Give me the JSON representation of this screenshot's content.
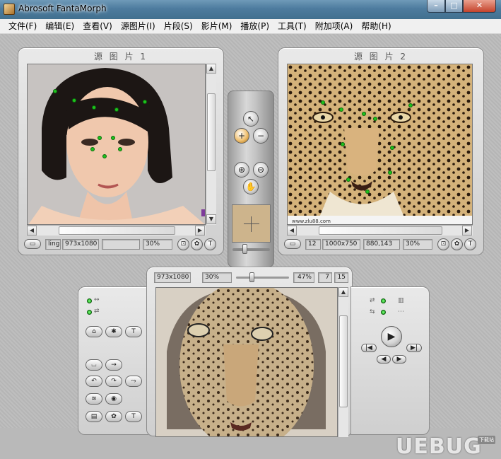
{
  "window": {
    "title": "Abrosoft FantaMorph",
    "min": "–",
    "max": "□",
    "close": "✕"
  },
  "menu": [
    "文件(F)",
    "编辑(E)",
    "查看(V)",
    "源图片(I)",
    "片段(S)",
    "影片(M)",
    "播放(P)",
    "工具(T)",
    "附加项(A)",
    "帮助(H)"
  ],
  "source1": {
    "title": "源 图 片 1",
    "name": "ling",
    "size": "973x1080",
    "coords": "",
    "zoom": "30%"
  },
  "source2": {
    "title": "源 图 片 2",
    "name": "12",
    "size": "1000x750",
    "coords": "880,143",
    "zoom": "30%",
    "credit": "www.zlu88.com"
  },
  "preview": {
    "size": "973x1080",
    "zoom": "30%",
    "percent": "47%",
    "frame": "7",
    "total": "15"
  },
  "watermark": {
    "text": "UEBUG",
    "sub": "下载站"
  },
  "icons": {
    "play": "play-icon",
    "arrow": "pointer-icon",
    "add": "add-point-icon",
    "remove": "remove-point-icon",
    "zoomin": "zoom-in-icon",
    "zoomout": "zoom-out-icon",
    "hand": "hand-icon"
  }
}
